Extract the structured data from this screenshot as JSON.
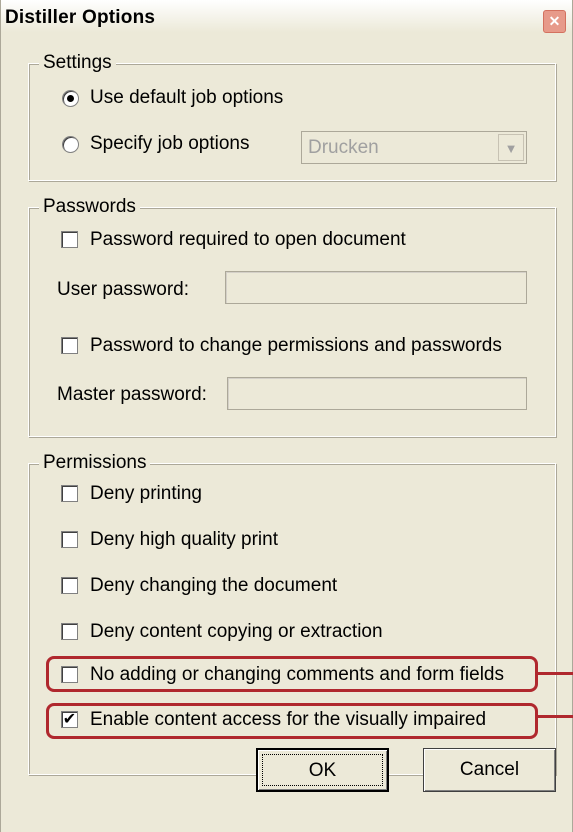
{
  "window": {
    "title": "Distiller Options",
    "close_glyph": "✕"
  },
  "settings": {
    "legend": "Settings",
    "use_default_label": "Use default job options",
    "use_default_selected": true,
    "specify_label": "Specify job options",
    "specify_selected": false,
    "joboptions_value": "Drucken",
    "dropdown_arrow": "▼"
  },
  "passwords": {
    "legend": "Passwords",
    "require_open_label": "Password required to open document",
    "require_open_checked": false,
    "user_password_label": "User password:",
    "user_password_value": "",
    "change_perms_label": "Password to change permissions and passwords",
    "change_perms_checked": false,
    "master_password_label": "Master password:",
    "master_password_value": ""
  },
  "permissions": {
    "legend": "Permissions",
    "items": [
      {
        "label": "Deny printing",
        "checked": false
      },
      {
        "label": "Deny high quality print",
        "checked": false
      },
      {
        "label": "Deny changing the document",
        "checked": false
      },
      {
        "label": "Deny content copying or extraction",
        "checked": false
      },
      {
        "label": "No adding or changing comments and form fields",
        "checked": false
      },
      {
        "label": "Enable content access for the visually impaired",
        "checked": true
      }
    ],
    "check_glyph": "✔"
  },
  "buttons": {
    "ok": "OK",
    "cancel": "Cancel"
  },
  "colors": {
    "dialog_bg": "#ece9d8",
    "highlight": "#b0282e",
    "close_button": "#e79a8a"
  }
}
